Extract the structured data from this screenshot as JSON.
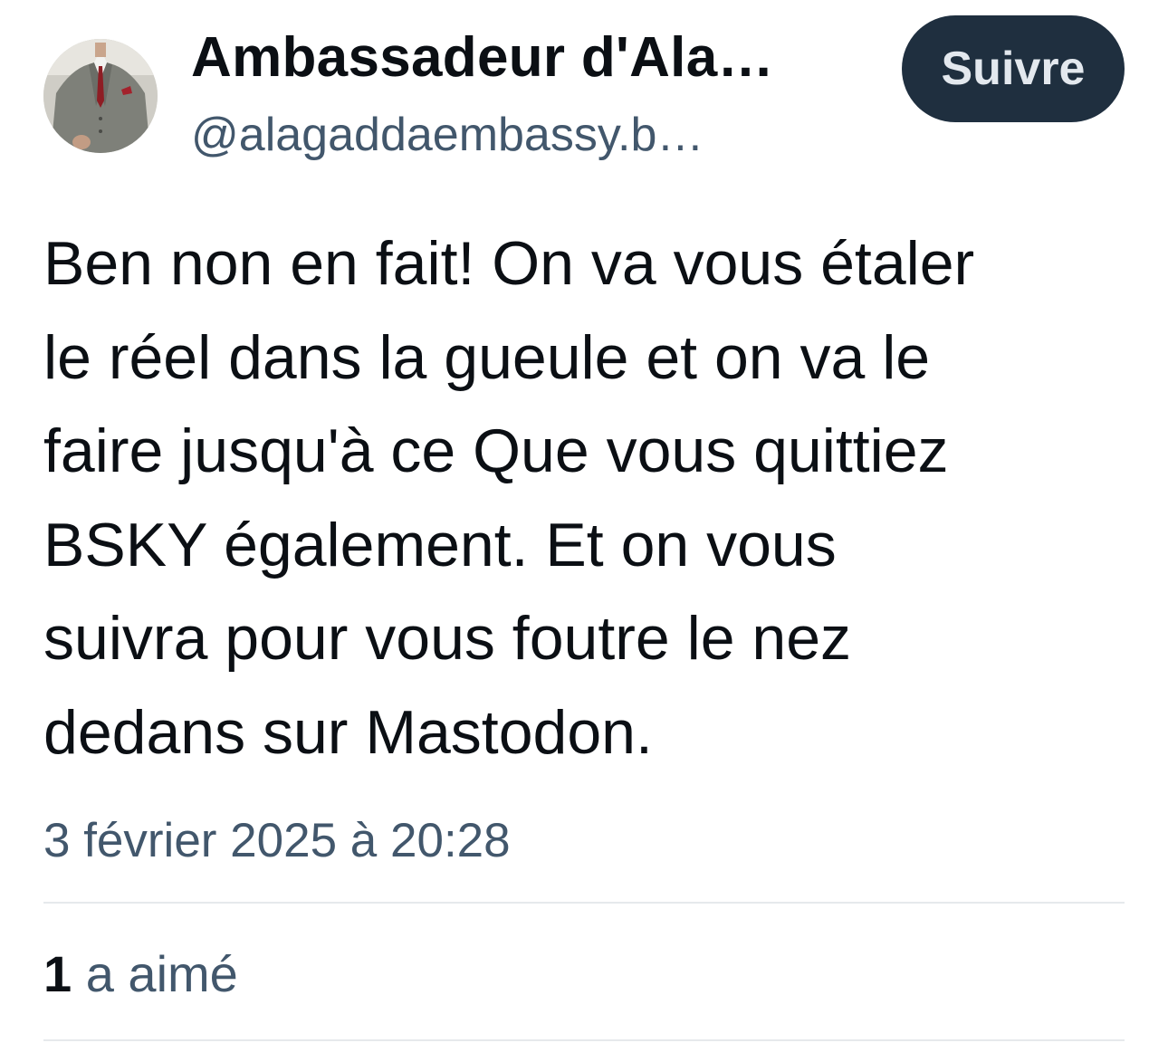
{
  "post": {
    "author": {
      "display_name": "Ambassadeur d'Ala…",
      "handle": "@alagaddaembassy.b…",
      "avatar_icon": "profile-photo-man-in-grey-suit"
    },
    "follow_label": "Suivre",
    "text_lines": [
      "Ben non en fait! On va vous étaler",
      "le réel dans la gueule et on va le",
      "faire jusqu'à ce Que vous quittiez",
      "BSKY également. Et on vous",
      "suivra pour vous foutre le nez",
      "dedans sur Mastodon."
    ],
    "timestamp": "3 février 2025 à 20:28",
    "likes": {
      "count": "1",
      "label": "a aimé"
    }
  },
  "colors": {
    "text_primary": "#0b0f14",
    "text_secondary": "#42576c",
    "follow_button_bg": "#1f2f3f",
    "follow_button_text": "#e3e8ee",
    "divider": "#e6e9ec"
  }
}
